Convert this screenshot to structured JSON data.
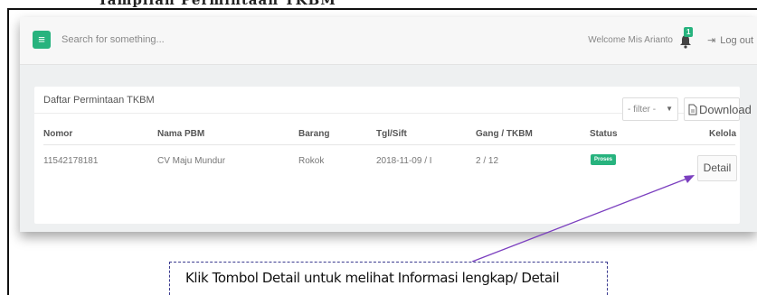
{
  "doc": {
    "cut_heading": "Tampilan Permintaan TKBM"
  },
  "topbar": {
    "menu_icon": "menu-icon",
    "search_placeholder": "Search for something...",
    "welcome": "Welcome Mis Arianto",
    "notifications": {
      "icon": "bell-icon",
      "count": "1"
    },
    "logout_label": "Log out",
    "logout_icon": "logout-icon"
  },
  "panel": {
    "title": "Daftar Permintaan TKBM",
    "filter": {
      "selected": "- filter -"
    },
    "download_label": "Download",
    "download_icon": "document-icon",
    "table": {
      "headers": [
        "Nomor",
        "Nama PBM",
        "Barang",
        "Tgl/Sift",
        "Gang / TKBM",
        "Status",
        "Kelola"
      ],
      "rows": [
        {
          "nomor": "11542178181",
          "nama_pbm": "CV Maju Mundur",
          "barang": "Rokok",
          "tgl_sift": "2018-11-09 / I",
          "gang_tkbm": "2 / 12",
          "status": "Proses",
          "kelola": "Detail"
        }
      ]
    }
  },
  "annotation": {
    "callout_text": "Klik Tombol Detail untuk melihat Informasi lengkap/ Detail",
    "arrow_color": "#7b3fbf"
  },
  "colors": {
    "accent": "#27b37e",
    "callout_border": "#3a3a8f"
  }
}
